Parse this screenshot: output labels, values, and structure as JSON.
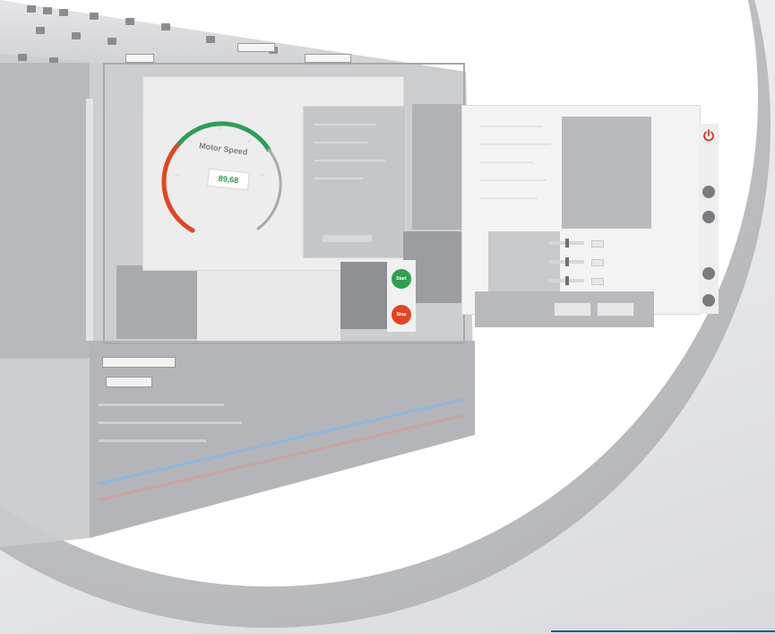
{
  "gauge": {
    "title": "Motor Speed",
    "value": "89,68"
  },
  "controls": {
    "start_label": "Start",
    "stop_label": "Stop"
  },
  "colors": {
    "gauge_green": "#2e9d55",
    "gauge_red": "#e2451f",
    "start_button": "#2ea04f",
    "stop_button": "#e2451f",
    "power_icon": "#d9362b",
    "accent_line": "#1f5c99"
  },
  "icons": {
    "power": "power-icon",
    "side_up": "chevron-up-icon",
    "side_down": "chevron-down-icon",
    "side_minus_1": "circle-icon",
    "side_minus_2": "circle-icon"
  }
}
